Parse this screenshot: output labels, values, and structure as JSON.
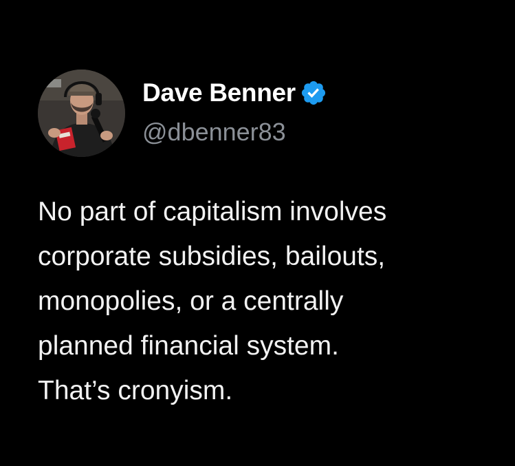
{
  "author": {
    "display_name": "Dave Benner",
    "handle": "@dbenner83",
    "verified_icon": "verified-badge-icon",
    "verified_color": "#1d9bf0"
  },
  "tweet": {
    "text": "No part of capitalism involves\ncorporate subsidies, bailouts,\nmonopolies, or a centrally\nplanned financial system.\nThat’s cronyism."
  },
  "colors": {
    "background": "#000000",
    "name": "#ffffff",
    "handle": "#8b9097",
    "text": "#f2f2f2"
  }
}
